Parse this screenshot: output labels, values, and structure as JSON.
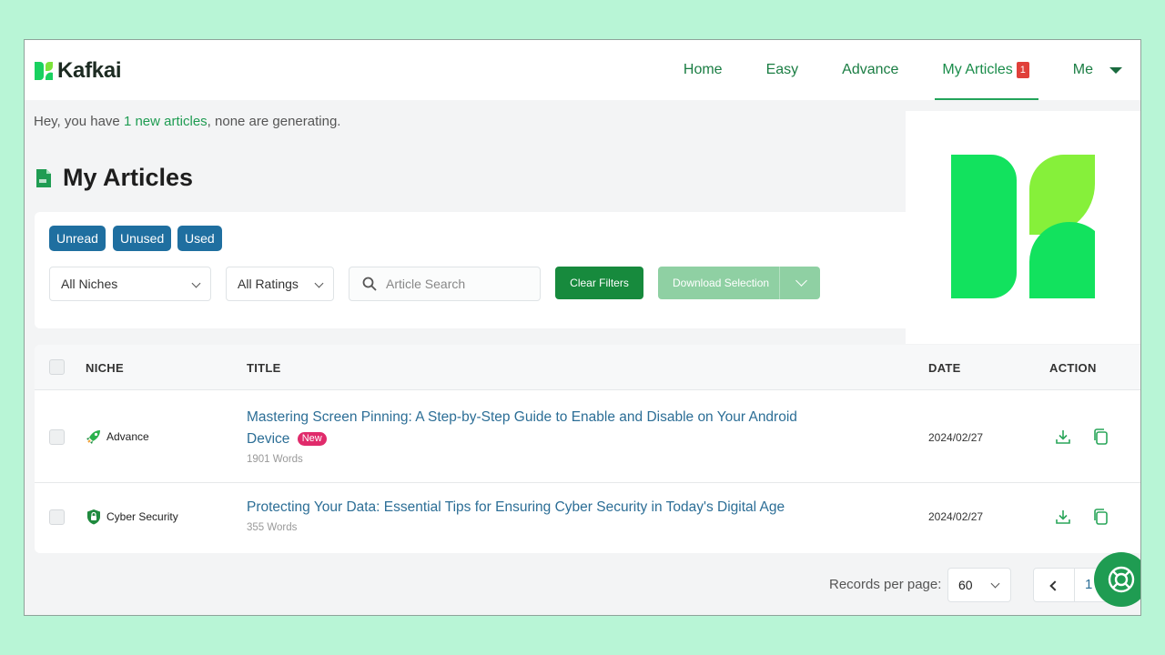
{
  "app": {
    "brand": "Kafkai",
    "colors": {
      "primary": "#178a3d",
      "accent": "#1f9c52",
      "chip": "#1f6fa0",
      "link": "#2c6e96",
      "badge": "#e0403a",
      "new_badge": "#e02b6b"
    }
  },
  "nav": {
    "home": "Home",
    "easy": "Easy",
    "advance": "Advance",
    "my_articles": "My Articles",
    "my_articles_count": "1",
    "me": "Me"
  },
  "notice": {
    "prefix": "Hey, you have ",
    "highlight": "1 new articles",
    "suffix": ", none are generating."
  },
  "page": {
    "title": "My Articles"
  },
  "filters": {
    "chips": [
      "Unread",
      "Unused",
      "Used"
    ],
    "niche_select": "All Niches",
    "rating_select": "All Ratings",
    "search_placeholder": "Article Search",
    "clear_label": "Clear Filters",
    "download_label": "Download Selection"
  },
  "table": {
    "headers": {
      "niche": "NICHE",
      "title": "TITLE",
      "date": "DATE",
      "action": "ACTION"
    },
    "rows": [
      {
        "niche": "Advance",
        "niche_icon": "rocket-icon",
        "title": "Mastering Screen Pinning: A Step-by-Step Guide to Enable and Disable on Your Android Device",
        "badge": "New",
        "words": "1901 Words",
        "date": "2024/02/27"
      },
      {
        "niche": "Cyber Security",
        "niche_icon": "shield-icon",
        "title": "Protecting Your Data: Essential Tips for Ensuring Cyber Security in Today's Digital Age",
        "badge": "",
        "words": "355 Words",
        "date": "2024/02/27"
      }
    ]
  },
  "pagination": {
    "records_label": "Records per page:",
    "records_value": "60",
    "current_page": "1"
  }
}
